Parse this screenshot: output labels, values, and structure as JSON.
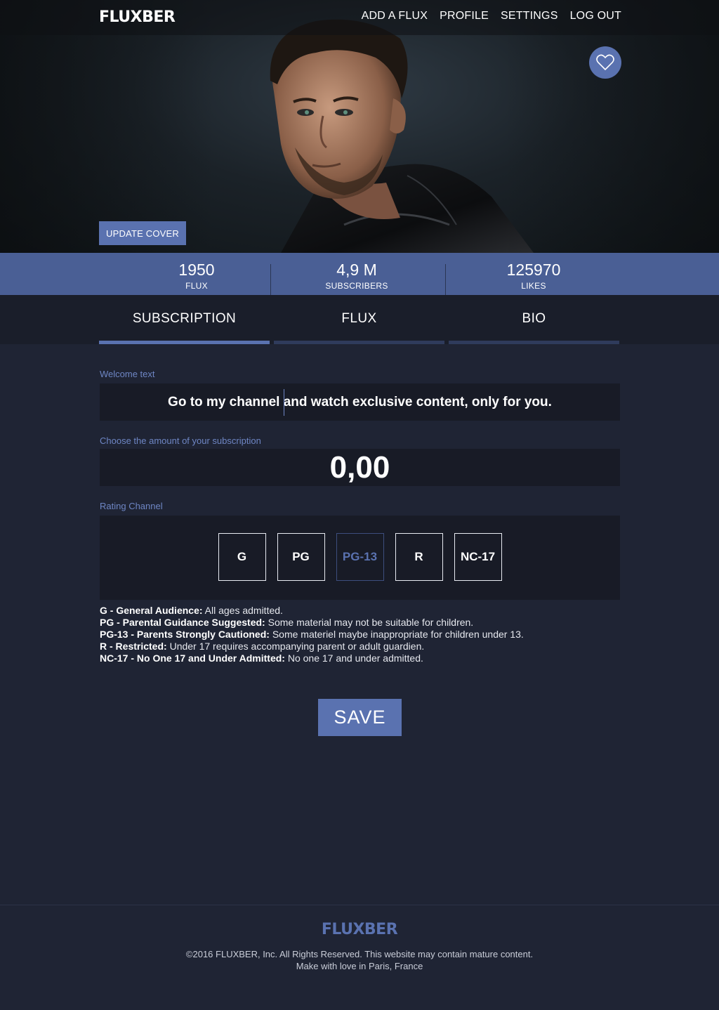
{
  "brand": {
    "name": "FLUXBER",
    "accent_color": "#5a72b0"
  },
  "nav": {
    "items": [
      "ADD A FLUX",
      "PROFILE",
      "SETTINGS",
      "LOG OUT"
    ]
  },
  "hero": {
    "update_cover_label": "UPDATE COVER",
    "favorite_icon": "heart-icon"
  },
  "stats": [
    {
      "value": "1950",
      "label": "FLUX"
    },
    {
      "value": "4,9 M",
      "label": "SUBSCRIBERS"
    },
    {
      "value": "125970",
      "label": "LIKES"
    }
  ],
  "tabs": [
    {
      "label": "SUBSCRIPTION",
      "active": true
    },
    {
      "label": "FLUX",
      "active": false
    },
    {
      "label": "BIO",
      "active": false
    }
  ],
  "form": {
    "welcome_label": "Welcome text",
    "welcome_value": "Go to my channel and watch exclusive content, only for you.",
    "amount_label": "Choose the amount of your subscription",
    "amount_value": "0,00",
    "rating_label": "Rating Channel",
    "ratings": [
      "G",
      "PG",
      "PG-13",
      "R",
      "NC-17"
    ],
    "selected_rating": "PG-13",
    "save_label": "SAVE"
  },
  "legend": [
    {
      "term": "G  - General Audience:",
      "desc": " All ages admitted."
    },
    {
      "term": "PG - Parental  Guidance Suggested:",
      "desc": " Some material may not be suitable for children."
    },
    {
      "term": "PG-13 - Parents Strongly Cautioned:",
      "desc": " Some materiel maybe inappropriate for children under 13."
    },
    {
      "term": "R - Restricted: ",
      "desc": " Under 17 requires accompanying parent or adult guardien."
    },
    {
      "term": "NC-17 - No One 17 and Under Admitted:",
      "desc": " No one 17 and under admitted."
    }
  ],
  "footer": {
    "logo": "FLUXBER",
    "copyright": "©2016 FLUXBER, Inc. All Rights Reserved. This website may contain mature content.",
    "tagline": "Make with love in Paris, France"
  }
}
